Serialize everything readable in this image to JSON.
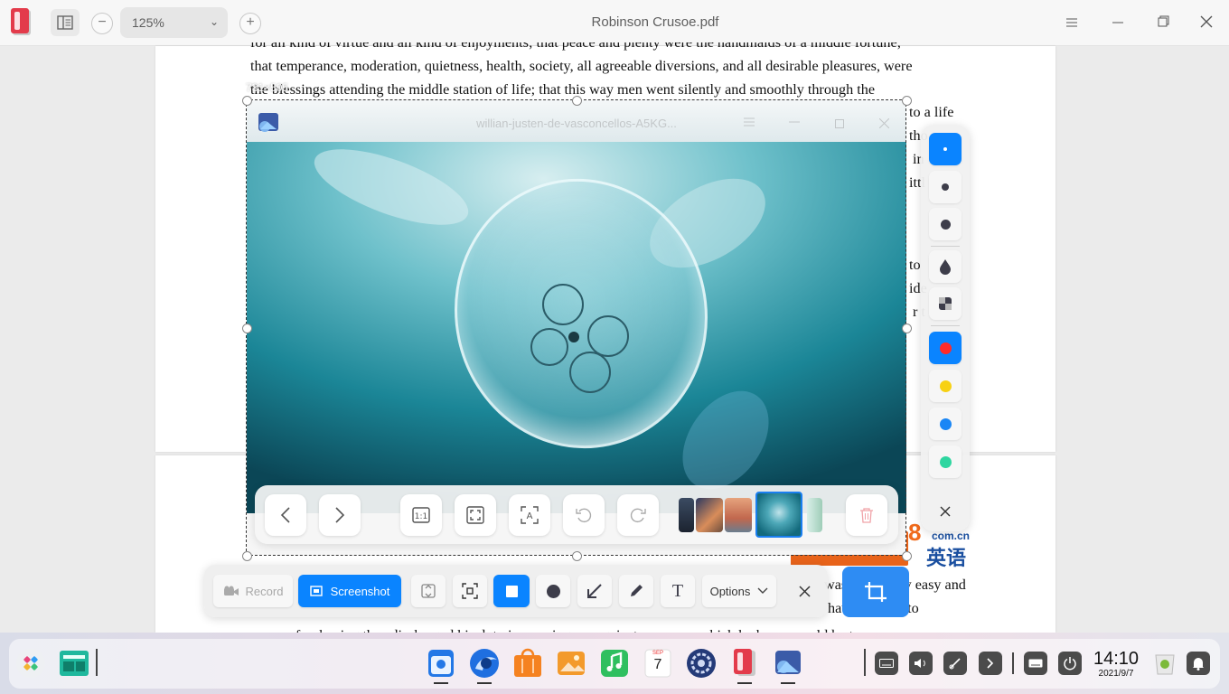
{
  "titlebar": {
    "zoom": "125%",
    "title": "Robinson Crusoe.pdf"
  },
  "document": {
    "lines_top": [
      "for all kind of virtue and all kind of enjoyments; that peace and plenty were the handmaids of a middle fortune;",
      "that temperance, moderation, quietness, health, society, all agreeable diversions, and all desirable pleasures, were",
      "the blessings attending the middle station of life; that this way men went silently and smoothly through the"
    ],
    "right_fragments": [
      "to a life",
      "tho",
      "in",
      "ittl",
      "to",
      "ide",
      "r t"
    ],
    "bottom_line_left": "was n",
    "bottom_line_left2": "ery easy and",
    "bottom_line2": "have nothing to",
    "bottom_line3": "answer for, having thus discharged his duty in warning me against measures which he knew would be to my",
    "banner_text": "8",
    "banner_domain": "com.cn",
    "banner_cn": "英语"
  },
  "selection": {
    "size_label": "731×505"
  },
  "image_viewer": {
    "title": "willian-justen-de-vasconcellos-A5KG..."
  },
  "screenshot_toolbar": {
    "record_label": "Record",
    "screenshot_label": "Screenshot",
    "options_label": "Options"
  },
  "palette": {
    "colors": {
      "red": "#ff2b2b",
      "yellow": "#f7d114",
      "blue": "#1a86f5",
      "green": "#2ed6a0",
      "accent": "#0a84ff"
    }
  },
  "taskbar": {
    "time": "14:10",
    "date": "2021/9/7",
    "calendar_month": "SEP",
    "calendar_day": "7"
  }
}
